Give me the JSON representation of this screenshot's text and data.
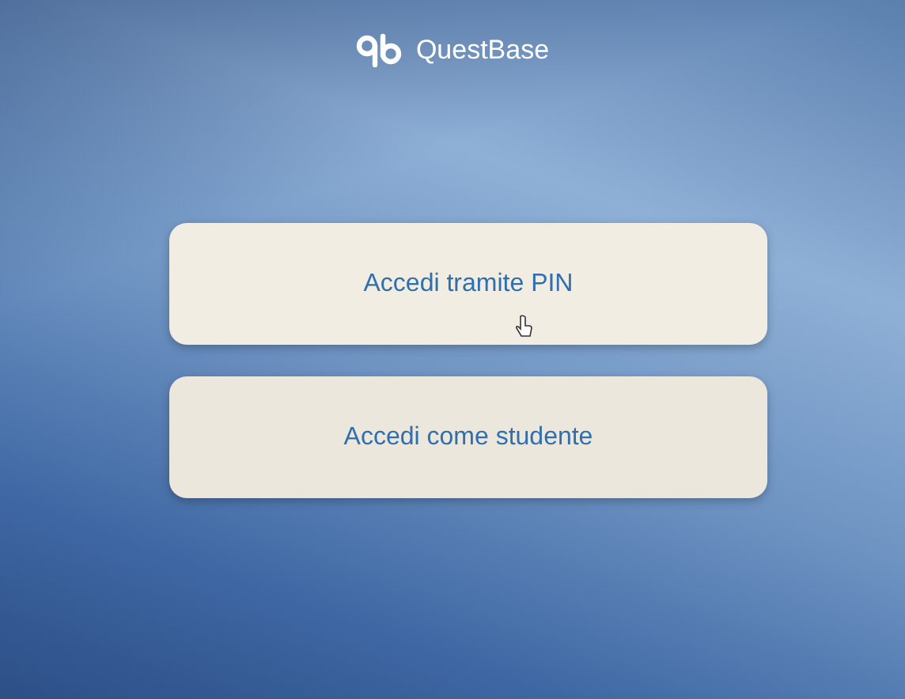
{
  "header": {
    "brand": "QuestBase"
  },
  "buttons": [
    {
      "label": "Accedi tramite PIN",
      "hovered": true
    },
    {
      "label": "Accedi come studente",
      "hovered": false
    }
  ]
}
